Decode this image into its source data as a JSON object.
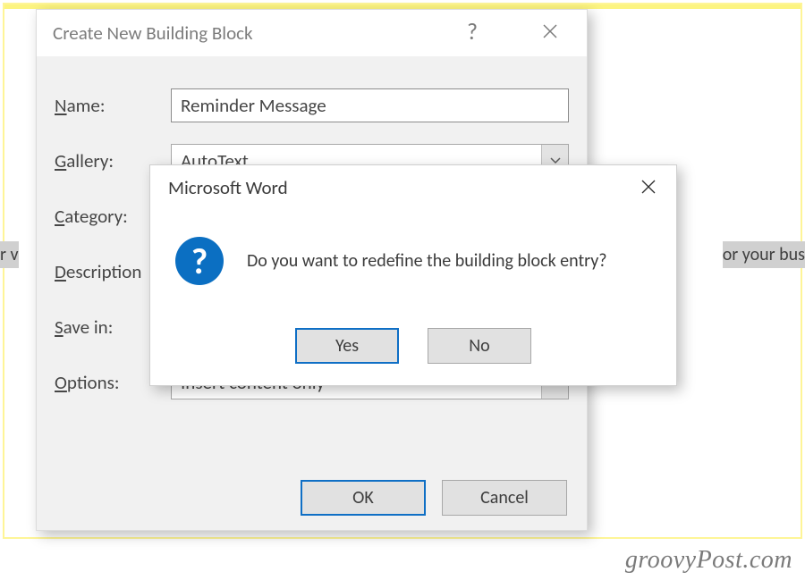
{
  "doc_text": {
    "left": "r v",
    "right": "or your bus"
  },
  "main_dialog": {
    "title": "Create New Building Block",
    "help": "?",
    "fields": {
      "name": {
        "label_pre": "N",
        "label_post": "ame:",
        "value": "Reminder Message"
      },
      "gallery": {
        "label_pre": "G",
        "label_post": "allery:",
        "value": "AutoText"
      },
      "category": {
        "label_pre": "C",
        "label_post": "ategory:",
        "value": ""
      },
      "description": {
        "label_pre": "D",
        "label_post": "escription",
        "value": ""
      },
      "save_in": {
        "label_pre": "S",
        "label_post": "ave in:",
        "value": ""
      },
      "options": {
        "label_pre": "O",
        "label_post": "ptions:",
        "value": "Insert content only"
      }
    },
    "ok": "OK",
    "cancel": "Cancel"
  },
  "confirm_dialog": {
    "title": "Microsoft Word",
    "icon_glyph": "?",
    "message": "Do you want to redefine the building block entry?",
    "yes": "Yes",
    "no": "No"
  },
  "watermark": "groovyPost.com"
}
